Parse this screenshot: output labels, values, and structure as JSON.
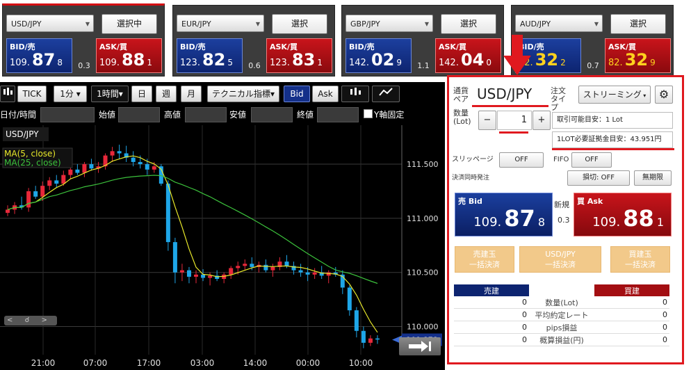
{
  "pairs": [
    {
      "symbol": "USD/JPY",
      "select_label": "選択中",
      "bid_label": "BID/売",
      "ask_label": "ASK/買",
      "bid": {
        "p1": "109.",
        "p2": "87",
        "p3": "8"
      },
      "ask": {
        "p1": "109.",
        "p2": "88",
        "p3": "1"
      },
      "spread": "0.3",
      "active": true
    },
    {
      "symbol": "EUR/JPY",
      "select_label": "選択",
      "bid_label": "BID/売",
      "ask_label": "ASK/買",
      "bid": {
        "p1": "123.",
        "p2": "82",
        "p3": "5"
      },
      "ask": {
        "p1": "123.",
        "p2": "83",
        "p3": "1"
      },
      "spread": "0.6",
      "active": false
    },
    {
      "symbol": "GBP/JPY",
      "select_label": "選択",
      "bid_label": "BID/売",
      "ask_label": "ASK/買",
      "bid": {
        "p1": "142.",
        "p2": "02",
        "p3": "9"
      },
      "ask": {
        "p1": "142.",
        "p2": "04",
        "p3": "0"
      },
      "spread": "1.1",
      "active": false
    },
    {
      "symbol": "AUD/JPY",
      "select_label": "選択",
      "bid_label": "BID/売",
      "ask_label": "ASK/買",
      "bid": {
        "p1": "82.",
        "p2": "32",
        "p3": "2"
      },
      "ask": {
        "p1": "82.",
        "p2": "32",
        "p3": "9"
      },
      "spread": "0.7",
      "active": false
    }
  ],
  "toolbar": {
    "chart_icon": "candlestick-icon",
    "tick": "TICK",
    "minute": "1分 ▾",
    "hour": "1時間▾",
    "day": "日",
    "week": "週",
    "month": "月",
    "technical": "テクニカル指標▾",
    "bid": "Bid",
    "ask": "Ask"
  },
  "filters": {
    "datetime": "日付/時間",
    "open": "始値",
    "high": "高値",
    "low": "安値",
    "close": "終値",
    "y_fixed": "Y軸固定"
  },
  "chart_data": {
    "type": "candlestick",
    "symbol": "USD/JPY",
    "legend": [
      {
        "name": "MA(5, close)",
        "color": "#e8e82a"
      },
      {
        "name": "MA(25, close)",
        "color": "#3cc23c"
      }
    ],
    "y_ticks": [
      "111.500",
      "111.000",
      "110.500",
      "110.000"
    ],
    "x_ticks": [
      "21:00",
      "07:00",
      "17:00",
      "03:00",
      "14:00",
      "00:00",
      "10:00"
    ],
    "ylim": [
      109.74,
      111.86
    ],
    "current_price": "109.878",
    "up_color": "#e8283a",
    "down_color": "#1ea6e8",
    "ohlc": [
      [
        111.05,
        111.12,
        111.02,
        111.08
      ],
      [
        111.08,
        111.15,
        111.04,
        111.12
      ],
      [
        111.12,
        111.2,
        111.08,
        111.1
      ],
      [
        111.1,
        111.28,
        111.06,
        111.25
      ],
      [
        111.25,
        111.3,
        111.18,
        111.2
      ],
      [
        111.2,
        111.34,
        111.16,
        111.3
      ],
      [
        111.3,
        111.38,
        111.26,
        111.35
      ],
      [
        111.35,
        111.4,
        111.28,
        111.32
      ],
      [
        111.32,
        111.44,
        111.3,
        111.4
      ],
      [
        111.4,
        111.48,
        111.36,
        111.45
      ],
      [
        111.45,
        111.5,
        111.4,
        111.42
      ],
      [
        111.42,
        111.52,
        111.38,
        111.5
      ],
      [
        111.5,
        111.55,
        111.44,
        111.46
      ],
      [
        111.46,
        111.52,
        111.42,
        111.48
      ],
      [
        111.48,
        111.6,
        111.45,
        111.58
      ],
      [
        111.58,
        111.66,
        111.52,
        111.62
      ],
      [
        111.62,
        111.68,
        111.55,
        111.6
      ],
      [
        111.6,
        111.67,
        111.52,
        111.56
      ],
      [
        111.56,
        111.62,
        111.48,
        111.52
      ],
      [
        111.52,
        111.58,
        111.46,
        111.5
      ],
      [
        111.5,
        111.55,
        111.4,
        111.45
      ],
      [
        111.45,
        111.52,
        111.42,
        111.48
      ],
      [
        111.48,
        111.5,
        111.3,
        111.32
      ],
      [
        111.32,
        111.35,
        110.7,
        110.78
      ],
      [
        110.78,
        110.82,
        110.4,
        110.5
      ],
      [
        110.5,
        110.58,
        110.42,
        110.52
      ],
      [
        110.52,
        110.55,
        110.4,
        110.46
      ],
      [
        110.46,
        110.52,
        110.4,
        110.48
      ],
      [
        110.48,
        110.53,
        110.42,
        110.45
      ],
      [
        110.45,
        110.5,
        110.38,
        110.47
      ],
      [
        110.47,
        110.52,
        110.42,
        110.44
      ],
      [
        110.44,
        110.5,
        110.4,
        110.48
      ],
      [
        110.48,
        110.56,
        110.44,
        110.54
      ],
      [
        110.54,
        110.6,
        110.48,
        110.56
      ],
      [
        110.56,
        110.62,
        110.52,
        110.58
      ],
      [
        110.58,
        110.64,
        110.52,
        110.55
      ],
      [
        110.55,
        110.6,
        110.5,
        110.57
      ],
      [
        110.57,
        110.62,
        110.5,
        110.52
      ],
      [
        110.52,
        110.58,
        110.46,
        110.55
      ],
      [
        110.55,
        110.64,
        110.52,
        110.6
      ],
      [
        110.6,
        110.66,
        110.54,
        110.56
      ],
      [
        110.56,
        110.6,
        110.48,
        110.52
      ],
      [
        110.52,
        110.58,
        110.46,
        110.5
      ],
      [
        110.5,
        110.55,
        110.42,
        110.48
      ],
      [
        110.48,
        110.54,
        110.44,
        110.5
      ],
      [
        110.5,
        110.56,
        110.44,
        110.47
      ],
      [
        110.47,
        110.52,
        110.4,
        110.5
      ],
      [
        110.5,
        110.55,
        110.46,
        110.48
      ],
      [
        110.48,
        110.52,
        110.3,
        110.36
      ],
      [
        110.36,
        110.38,
        110.1,
        110.15
      ],
      [
        110.15,
        110.18,
        109.9,
        109.96
      ],
      [
        109.96,
        110.0,
        109.8,
        109.85
      ],
      [
        109.85,
        109.92,
        109.82,
        109.89
      ],
      [
        109.89,
        109.92,
        109.84,
        109.88
      ]
    ]
  },
  "order": {
    "pair_label": "通貨ペア",
    "pair_value": "USD/JPY",
    "type_label": "注文タイプ",
    "type_value": "ストリーミング",
    "gear_icon": "gear-icon",
    "qty_label": "数量(Lot)",
    "minus": "−",
    "qty_value": "1",
    "plus": "+",
    "tradable": "取引可能目安：1 Lot",
    "margin": "1LOT必要証拠金目安：43.951円",
    "slippage_label": "スリッページ",
    "slippage_value": "OFF",
    "fifo_label": "FIFO",
    "fifo_value": "OFF",
    "settle_label": "決済同時発注",
    "stoploss": "損切: OFF",
    "unlimited": "無期限",
    "bid_label": "売 Bid",
    "ask_label": "買 Ask",
    "bid": {
      "p1": "109.",
      "p2": "87",
      "p3": "8"
    },
    "ask": {
      "p1": "109.",
      "p2": "88",
      "p3": "1"
    },
    "new_label": "新規",
    "spread": "0.3",
    "settle_sell": "売建玉\n一括決済",
    "settle_pair": "USD/JPY\n一括決済",
    "settle_buy": "買建玉\n一括決済",
    "table": {
      "sell_header": "売建",
      "buy_header": "買建",
      "rows": [
        {
          "label": "数量(Lot)",
          "sell": "0",
          "buy": "0"
        },
        {
          "label": "平均約定レート",
          "sell": "0",
          "buy": "0"
        },
        {
          "label": "pips損益",
          "sell": "0",
          "buy": "0"
        },
        {
          "label": "概算損益(円)",
          "sell": "0",
          "buy": "0"
        }
      ]
    }
  }
}
